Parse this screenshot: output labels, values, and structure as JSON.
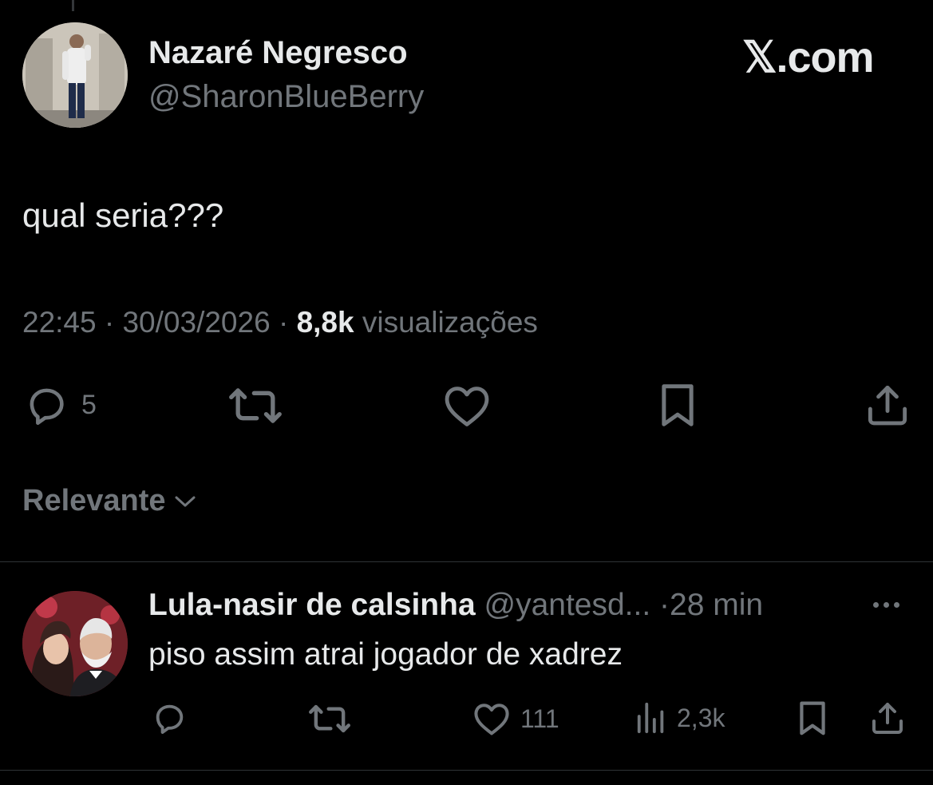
{
  "tweet": {
    "author_name": "Nazaré Negresco",
    "author_handle": "@SharonBlueBerry",
    "brand": "𝕏.com",
    "text": "qual seria???",
    "time": "22:45",
    "separator": " · ",
    "date": "30/03/2026",
    "views_count": "8,8k",
    "views_label": " visualizações",
    "reply_count": "5"
  },
  "sort": {
    "label": "Relevante"
  },
  "reply": {
    "author_name": "Lula-nasir de calsinha",
    "author_handle": "@yantesd...",
    "separator": " ·",
    "time": "28 min",
    "text": "piso assim atrai jogador de xadrez",
    "like_count": "111",
    "view_count": "2,3k"
  },
  "icons": {
    "reply": "reply-icon",
    "repost": "repost-icon",
    "like": "heart-icon",
    "bookmark": "bookmark-icon",
    "share": "share-icon",
    "views": "views-icon",
    "more": "more-icon",
    "chevron": "chevron-down-icon"
  },
  "colors": {
    "background": "#000000",
    "primary_text": "#e7e9ea",
    "secondary_text": "#71767b",
    "divider": "#2f3336"
  }
}
